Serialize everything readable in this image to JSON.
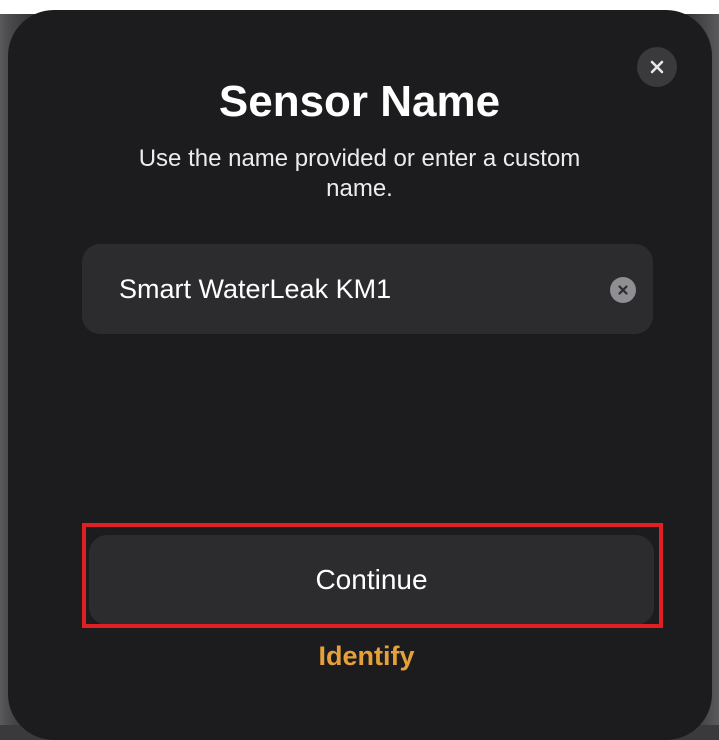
{
  "dialog": {
    "title": "Sensor Name",
    "subtitle": "Use the name provided or enter a custom name.",
    "close_icon": "close-icon"
  },
  "name_field": {
    "value": "Smart WaterLeak KM1",
    "clear_icon": "clear-circle-icon"
  },
  "actions": {
    "continue_label": "Continue",
    "identify_label": "Identify"
  },
  "colors": {
    "sheet_background": "#1c1c1e",
    "field_background": "#2c2c2e",
    "accent": "#e5a03a",
    "highlight": "#e01e24"
  }
}
